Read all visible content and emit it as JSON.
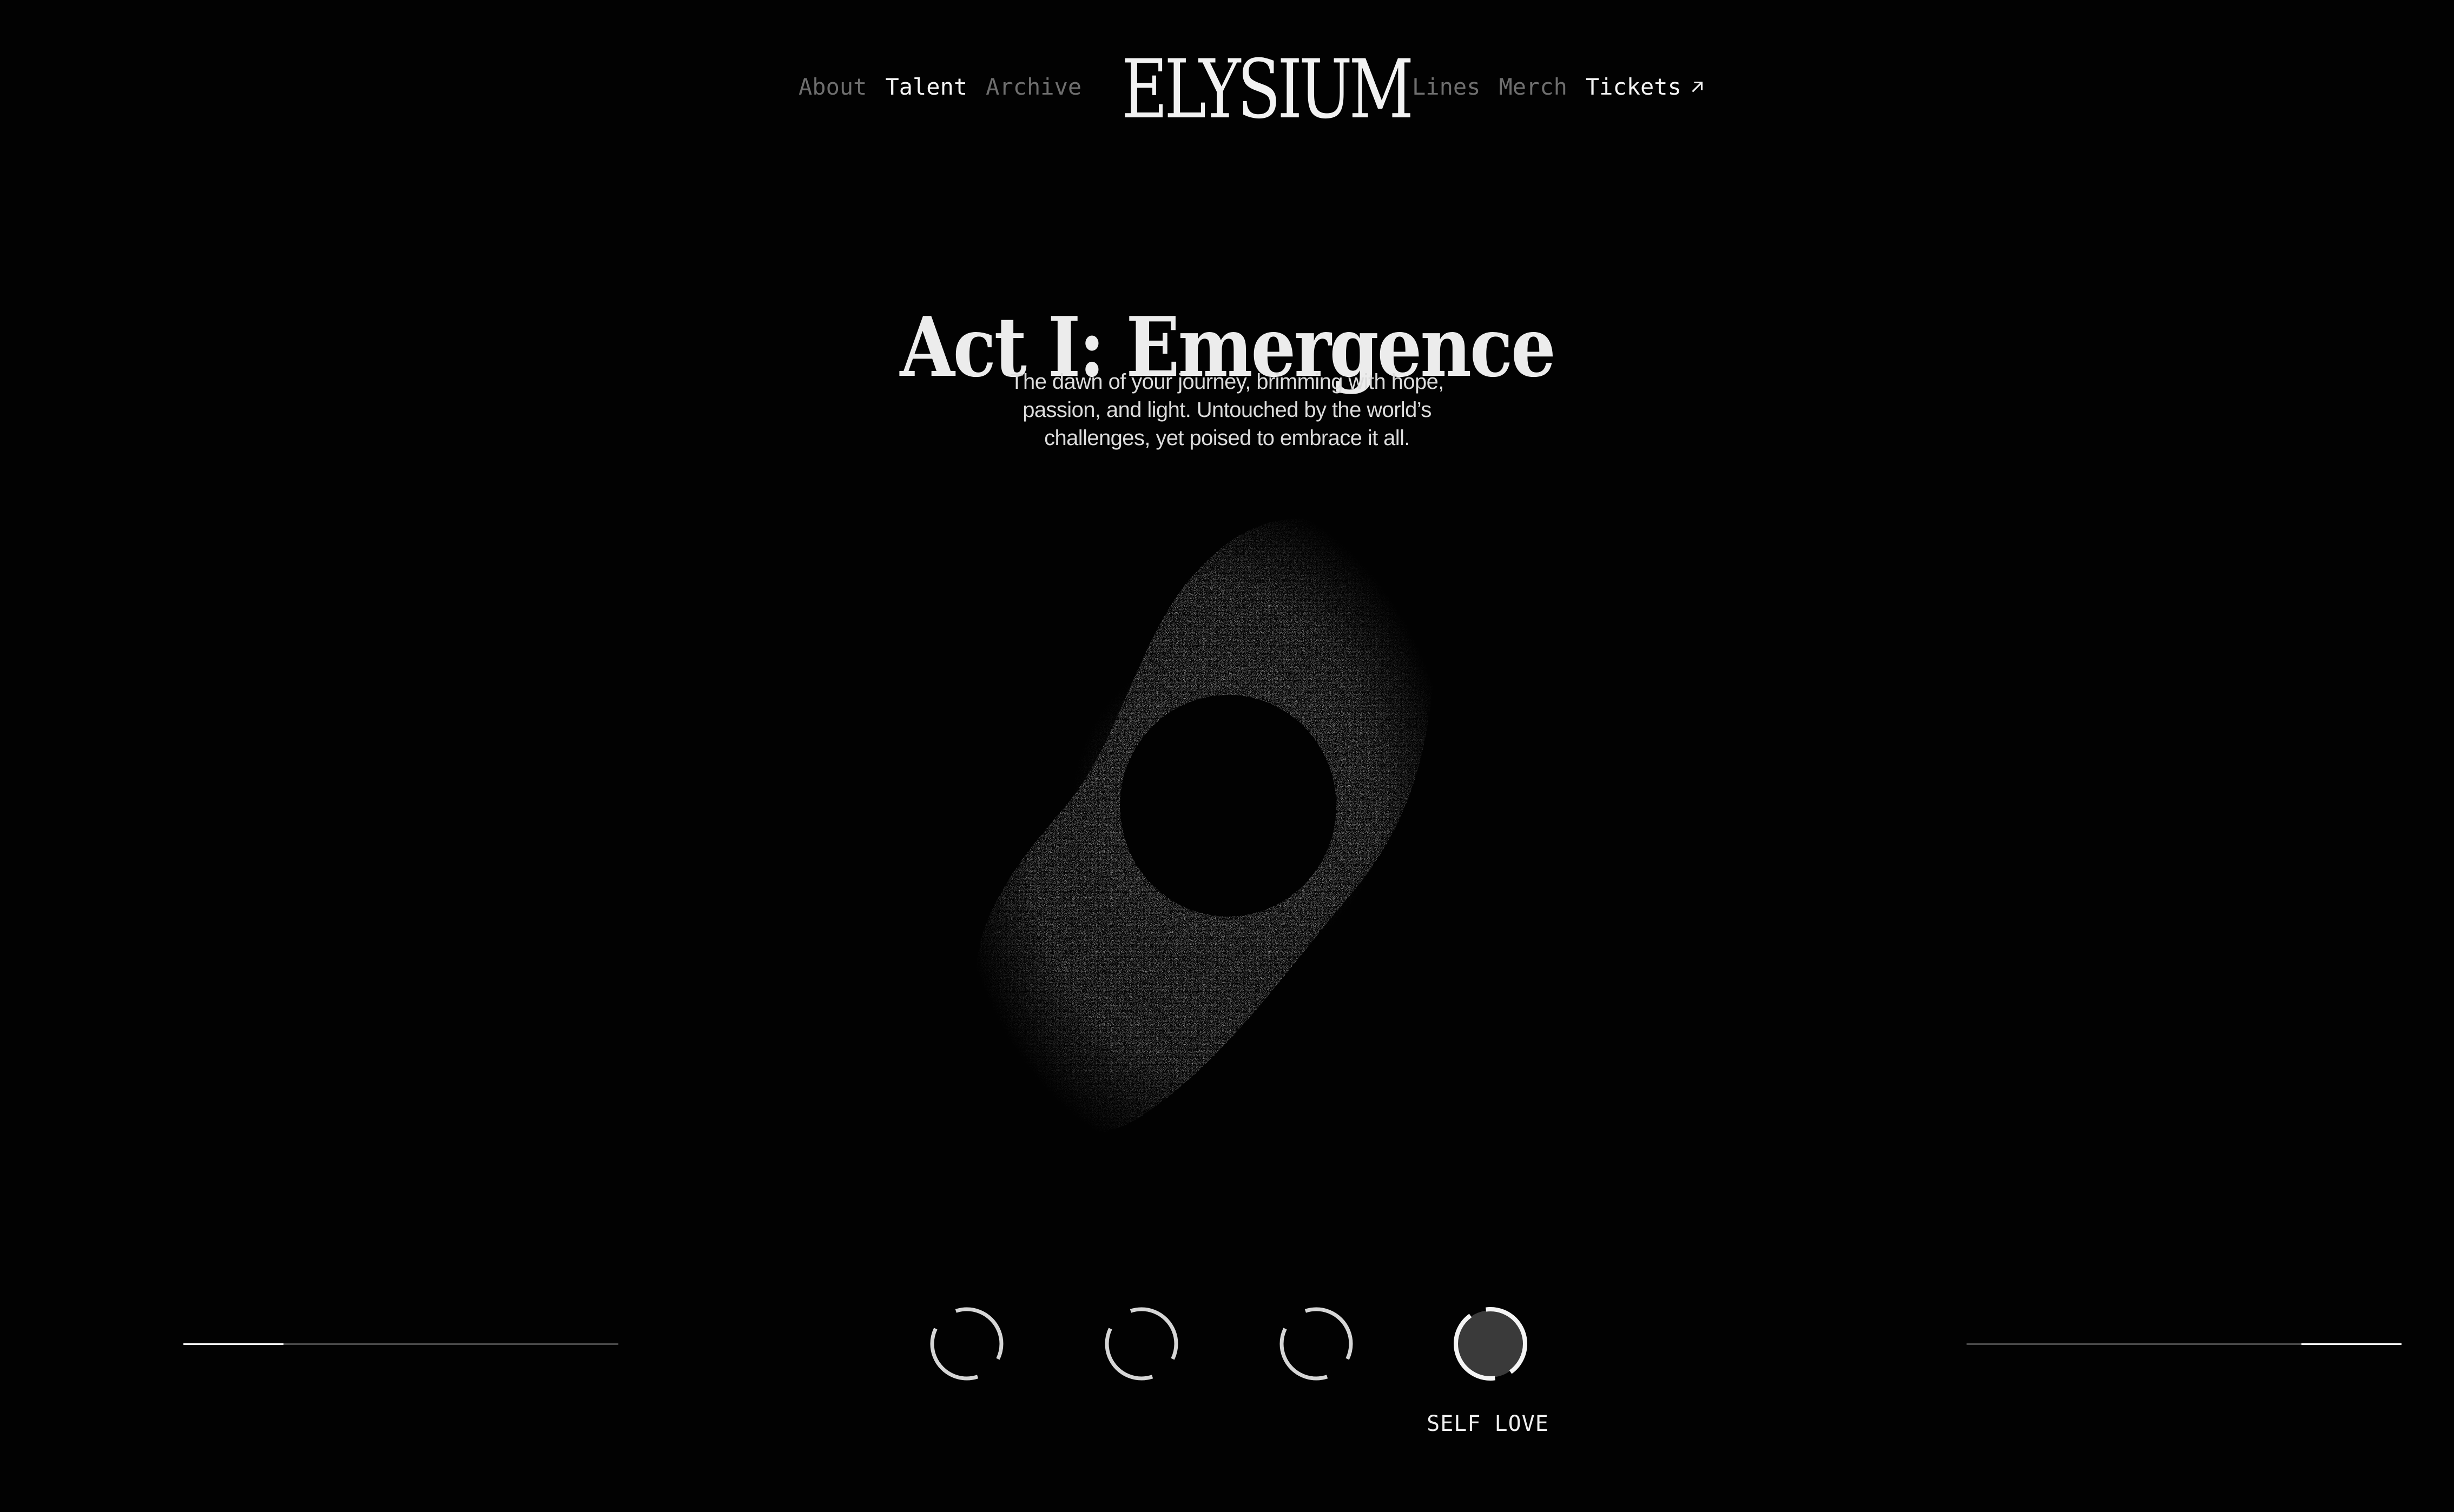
{
  "nav": {
    "left": [
      {
        "label": "About",
        "active": false
      },
      {
        "label": "Talent",
        "active": true
      },
      {
        "label": "Archive",
        "active": false
      }
    ],
    "logo": "ELYSIUM",
    "right": [
      {
        "label": "Lines",
        "active": false
      },
      {
        "label": "Merch",
        "active": false
      },
      {
        "label": "Tickets",
        "active": true,
        "icon": "arrow-up-right-icon"
      }
    ]
  },
  "hero": {
    "title": "Act I: Emergence",
    "description": "The dawn of your journey, brimming with hope, passion, and light. Untouched by the world’s challenges, yet poised to embrace it all."
  },
  "acts": {
    "items": [
      {
        "icon": "act-ring-icon",
        "selected": false
      },
      {
        "icon": "act-ring-icon",
        "selected": false
      },
      {
        "icon": "act-ring-icon",
        "selected": false
      },
      {
        "icon": "act-ring-icon",
        "selected": true
      }
    ],
    "selected_label": "SELF LOVE"
  },
  "progress": {
    "left_fraction": 0.23,
    "right_fraction": 0.23
  },
  "colors": {
    "background": "#020202",
    "text_primary": "#f0f0f0",
    "text_muted": "#6e6e6e",
    "accent_fill": "#3a3a3a"
  }
}
